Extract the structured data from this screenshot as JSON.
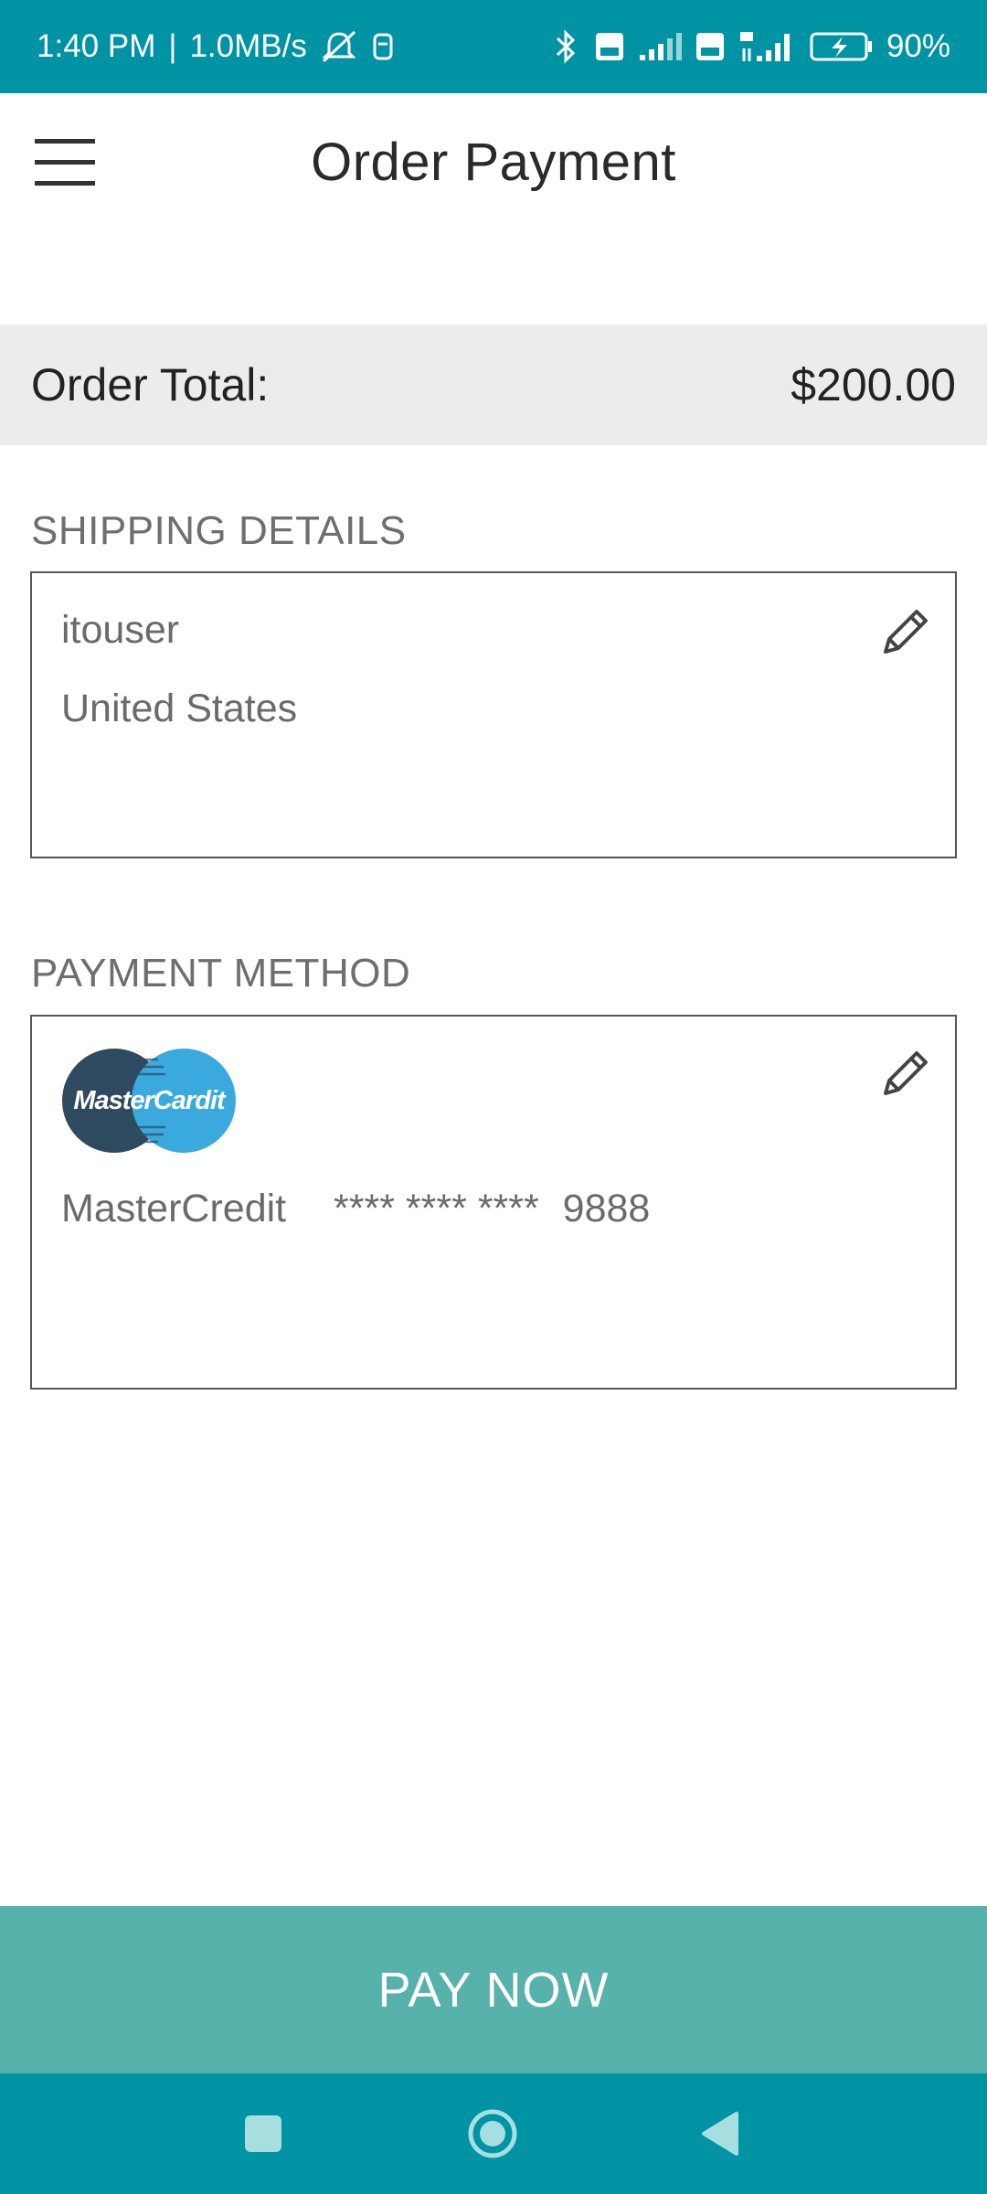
{
  "status_bar": {
    "time": "1:40 PM",
    "separator": "|",
    "speed": "1.0MB/s",
    "battery": "90%"
  },
  "header": {
    "title": "Order Payment"
  },
  "order": {
    "total_label": "Order Total:",
    "total_amount": "$200.00"
  },
  "shipping": {
    "section_label": "SHIPPING DETAILS",
    "name": "itouser",
    "country": "United States"
  },
  "payment": {
    "section_label": "PAYMENT METHOD",
    "logo_text": "MasterCardit",
    "card_brand": "MasterCredit",
    "card_mask": "**** **** ****",
    "card_last4": "9888"
  },
  "actions": {
    "pay_label": "PAY NOW"
  },
  "colors": {
    "status_bar": "#0093a3",
    "nav_bar": "#0093a3",
    "pay_button": "#56b2ab",
    "total_bar": "#ececec",
    "logo_left": "#2e4a5f",
    "logo_right": "#3aa9dd"
  }
}
